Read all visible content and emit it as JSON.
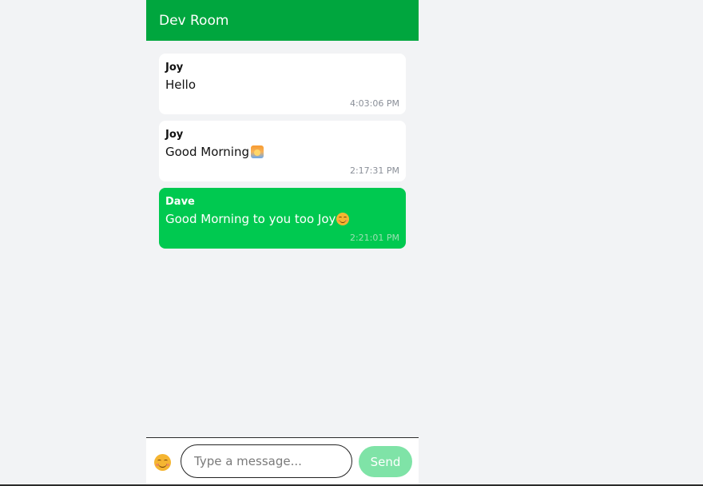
{
  "room": {
    "title": "Dev Room"
  },
  "messages": [
    {
      "sender": "Joy",
      "text": "Hello",
      "time": "4:03:06 PM",
      "own": false,
      "emoji": ""
    },
    {
      "sender": "Joy",
      "text": "Good Morning",
      "time": "2:17:31 PM",
      "own": false,
      "emoji": "sunrise-emoji"
    },
    {
      "sender": "Dave",
      "text": "Good Morning to you too Joy",
      "time": "2:21:01 PM",
      "own": true,
      "emoji": "smiling-face-emoji"
    }
  ],
  "composer": {
    "emoji_button_icon": "smiling-face-icon",
    "placeholder": "Type a message...",
    "value": "",
    "send_label": "Send"
  },
  "colors": {
    "header": "#00a63e",
    "own_bubble": "#00c950",
    "send_button": "#7fe3a7",
    "background": "#f2f3f5"
  }
}
